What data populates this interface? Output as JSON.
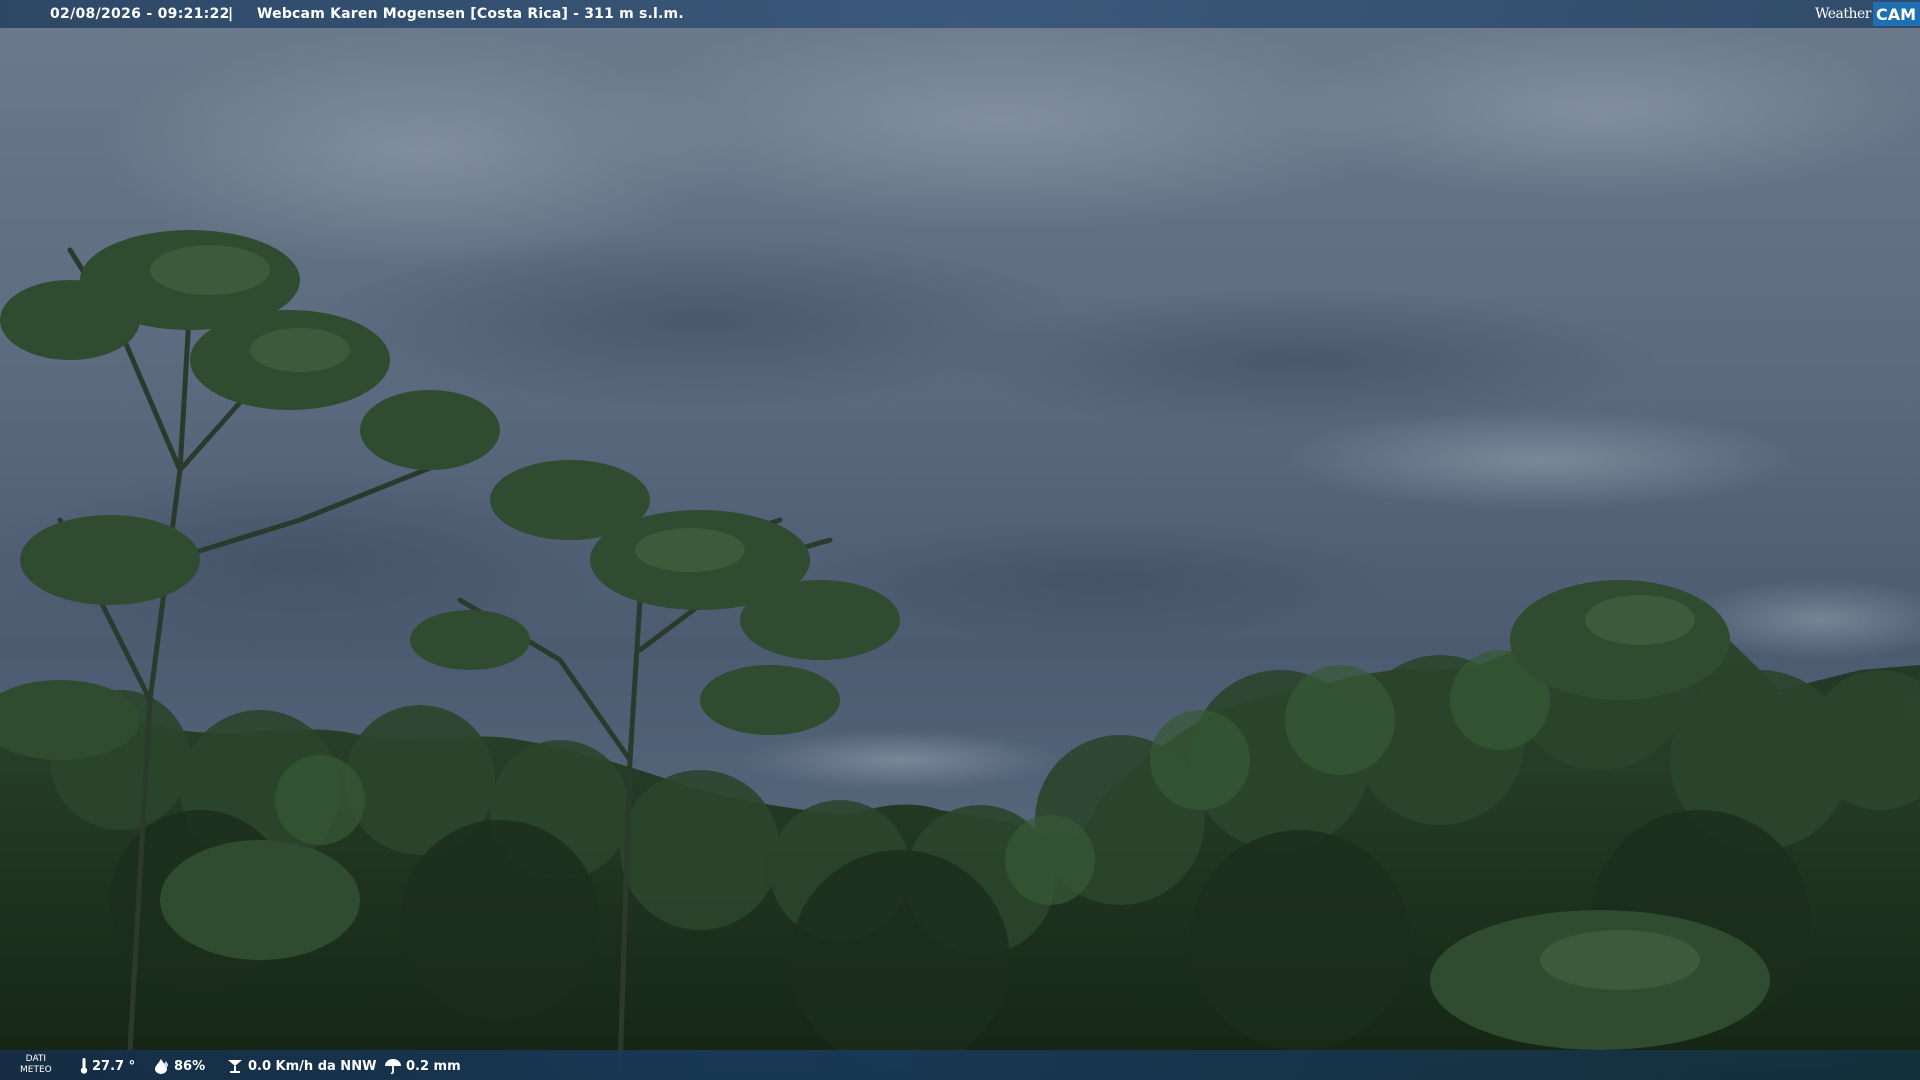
{
  "header": {
    "datetime": "02/08/2026 - 09:21:22",
    "separator": "|",
    "title": "Webcam Karen Mogensen [Costa Rica]  - 311 m s.l.m.",
    "brand_left": "Weather",
    "brand_right": "CAM"
  },
  "weather_data": {
    "section_label_line1": "DATI",
    "section_label_line2": "METEO",
    "temperature": "27.7 °",
    "humidity": "86%",
    "wind": "0.0 Km/h da NNW",
    "rain": "0.2 mm",
    "icons": [
      "thermometer-icon",
      "humidity-icon",
      "wind-icon",
      "rain-icon"
    ]
  },
  "colors": {
    "bar": "#2c4a6c",
    "brand_cam": "#1f6fb3",
    "sky": "#5d6c7e",
    "foliage": "#233823"
  }
}
